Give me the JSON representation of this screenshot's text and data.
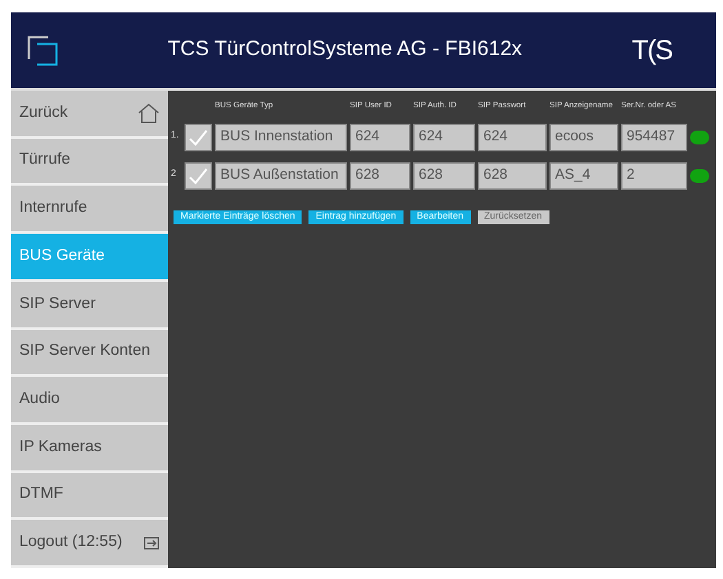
{
  "header": {
    "title": "TCS TürControlSysteme AG - FBI612x",
    "logo": "T(S"
  },
  "sidebar": {
    "items": [
      {
        "label": "Zurück",
        "kind": "home",
        "selected": false
      },
      {
        "label": "Türrufe",
        "kind": "plain",
        "selected": false
      },
      {
        "label": "Internrufe",
        "kind": "plain",
        "selected": false
      },
      {
        "label": "BUS Geräte",
        "kind": "plain",
        "selected": true
      },
      {
        "label": "SIP Server",
        "kind": "plain",
        "selected": false
      },
      {
        "label": "SIP Server Konten",
        "kind": "plain",
        "selected": false
      },
      {
        "label": "Audio",
        "kind": "plain",
        "selected": false
      },
      {
        "label": "IP Kameras",
        "kind": "plain",
        "selected": false
      },
      {
        "label": "DTMF",
        "kind": "plain",
        "selected": false
      },
      {
        "label": "Logout (12:55)",
        "kind": "logout",
        "selected": false
      }
    ]
  },
  "table": {
    "columns": [
      "BUS Geräte Typ",
      "SIP User ID",
      "SIP Auth. ID",
      "SIP Passwort",
      "SIP Anzeigename",
      "Ser.Nr. oder AS"
    ],
    "rows": [
      {
        "index": "1.",
        "checked": true,
        "cells": [
          "BUS Innenstation",
          "624",
          "624",
          "624",
          "ecoos",
          "954487"
        ],
        "color": "#11a311"
      },
      {
        "index": "2",
        "checked": true,
        "cells": [
          "BUS Außenstation",
          "628",
          "628",
          "628",
          "AS_4",
          "2"
        ],
        "color": "#11a311"
      }
    ]
  },
  "buttons": [
    {
      "label": "Markierte Einträge löschen",
      "disabled": false
    },
    {
      "label": "Eintrag hinzufügen",
      "disabled": false
    },
    {
      "label": "Bearbeiten",
      "disabled": false
    },
    {
      "label": "Zurücksetzen",
      "disabled": true
    }
  ]
}
